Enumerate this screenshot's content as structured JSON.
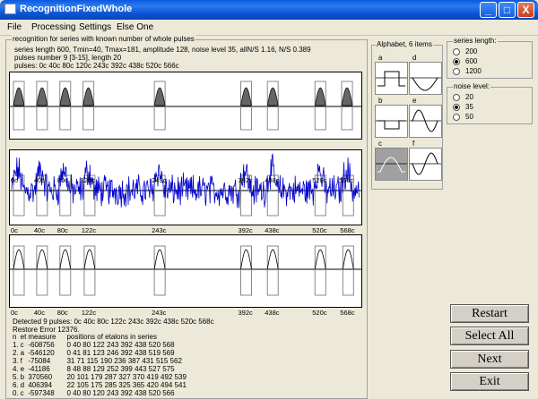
{
  "window": {
    "title": "RecognitionFixedWhole",
    "min_label": "_",
    "max_label": "□",
    "close_label": "X"
  },
  "menu": [
    "File",
    "Processing",
    "Settings",
    "Else One"
  ],
  "info": {
    "group_label": "recognition for series with known number of whole pulses",
    "line1": "series length 600,  Tmin=40,  Tmax=181,   amplitude 128,  noise level 35,  allN/S 1.16,  N/S 0.389",
    "line2": "pulses number 9 [3-15], length 20",
    "line3": "pulses:  0c 40c 80c 120c 243c 392c 438c 520c 566c"
  },
  "plot1_labels": [
    "0c",
    "40c",
    "80c",
    "120c",
    "243c",
    "392c",
    "438c",
    "520c",
    "566c"
  ],
  "plot2_labels": [
    "0c",
    "40c",
    "80c",
    "122c",
    "243c",
    "392c",
    "438c",
    "520c",
    "568c"
  ],
  "plot3_labels": [
    "0c",
    "40c",
    "80c",
    "122c",
    "243c",
    "392c",
    "438c",
    "520c",
    "568c"
  ],
  "alphabet": {
    "label": "Alphabet, 6 items",
    "letters": [
      "a",
      "b",
      "c",
      "d",
      "e",
      "f"
    ]
  },
  "series_length": {
    "label": "series length:",
    "options": [
      "200",
      "600",
      "1200"
    ],
    "selected": "600"
  },
  "noise_level": {
    "label": "noise level:",
    "options": [
      "20",
      "35",
      "50"
    ],
    "selected": "35"
  },
  "results": {
    "detected": "Detected 9 pulses:  0c 40c 80c 122c 243c 392c 438c 520c 568c",
    "restore": "Restore Error 12376.",
    "header": [
      "n",
      "et",
      "measure",
      "positions of etalons in series"
    ],
    "rows": [
      [
        "1.",
        "c",
        "-608756",
        "0  40  80  122  243  392  438  520  568"
      ],
      [
        "2.",
        "a",
        "-546120",
        "0  41  81  123  246  392  438  519  569"
      ],
      [
        "3.",
        "f",
        "-75084",
        "31  71  115  190  236  387  431  515  562"
      ],
      [
        "4.",
        "e",
        "-41186",
        "8  48  88  129  252  399  443  527  575"
      ],
      [
        "5.",
        "b",
        "370560",
        "20  101  179  287  327  370  419  492  539"
      ],
      [
        "6.",
        "d",
        "406394",
        "22  105  175  285  325  365  420  494  541"
      ],
      [
        "0.",
        "c",
        "-597348",
        "0  40  80  120  243  392  438  520  566"
      ]
    ]
  },
  "buttons": {
    "restart": "Restart",
    "select_all": "Select All",
    "next": "Next",
    "exit": "Exit"
  }
}
